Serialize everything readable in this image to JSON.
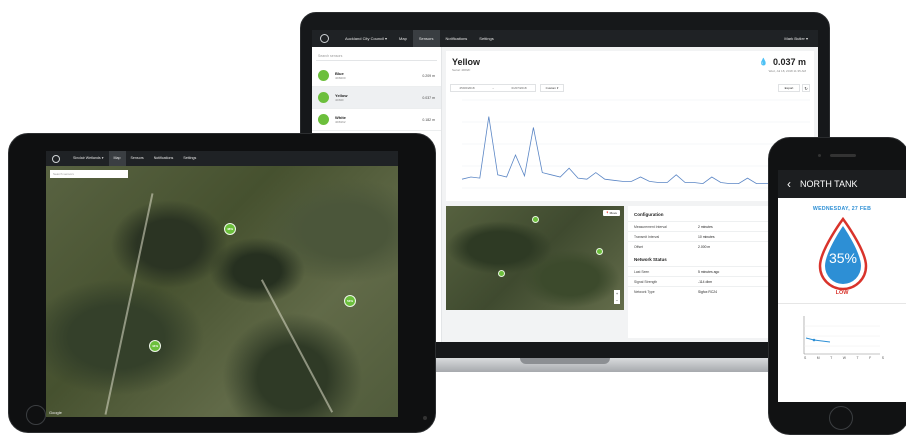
{
  "laptop": {
    "nav": {
      "org": "Auckland City Council ▾",
      "items": [
        "Map",
        "Sensors",
        "Notifications",
        "Settings"
      ],
      "active": "Sensors",
      "user": "Mark Butler ▾"
    },
    "sidebar": {
      "search_placeholder": "Search sensors",
      "sensors": [
        {
          "name": "Blue",
          "id": "4D8200",
          "value": "0.209 m"
        },
        {
          "name": "Yellow",
          "id": "4D82F",
          "value": "0.037 m"
        },
        {
          "name": "White",
          "id": "4D8162",
          "value": "0.182 m"
        }
      ]
    },
    "detail": {
      "title": "Yellow",
      "serial": "Serial: 4D82F",
      "reading": "0.037 m",
      "reading_time": "Wed, Jul 18, 2018 11:35 AM",
      "date_from": "25/06/2018",
      "date_arrow": "→",
      "date_to": "01/07/2018",
      "custom_label": "Custom ▾",
      "export_label": "Export",
      "refresh_glyph": "↻"
    },
    "map": {
      "move_label": "Move",
      "zoom_in": "+",
      "zoom_out": "−"
    },
    "configuration": {
      "heading": "Configuration",
      "rows": [
        {
          "label": "Measurement Interval",
          "value": "2 minutes"
        },
        {
          "label": "Transmit Interval",
          "value": "10 minutes"
        },
        {
          "label": "Offset",
          "value": "2.000 m"
        }
      ]
    },
    "network": {
      "heading": "Network Status",
      "rows": [
        {
          "label": "Last Seen",
          "value": "5 minutes ago"
        },
        {
          "label": "Signal Strength",
          "value": "-114 dbm"
        },
        {
          "label": "Network Type",
          "value": "Sigfox RC24"
        }
      ]
    }
  },
  "tablet": {
    "nav": {
      "org": "Sinclair Wetlands ▾",
      "items": [
        "Map",
        "Sensors",
        "Notifications",
        "Settings"
      ],
      "active": "Map"
    },
    "search_placeholder": "Search sensors",
    "markers": [
      "48%",
      "53%",
      "44%"
    ],
    "attribution": "Google"
  },
  "phone": {
    "title": "NORTH TANK",
    "date": "WEDNESDAY, 27 FEB",
    "level": "35%",
    "status": "LOW",
    "days": [
      "S",
      "M",
      "T",
      "W",
      "T",
      "F",
      "S"
    ]
  },
  "chart_data": {
    "type": "line",
    "title": "",
    "xlabel": "",
    "ylabel": "",
    "x": [
      0,
      1,
      2,
      3,
      4,
      5,
      6,
      7,
      8,
      9,
      10,
      11,
      12,
      13,
      14,
      15,
      16,
      17,
      18,
      19,
      20,
      21,
      22,
      23,
      24,
      25,
      26,
      27,
      28,
      29,
      30,
      31,
      32,
      33,
      34,
      35,
      36,
      37,
      38,
      39
    ],
    "series": [
      {
        "values": [
          0.08,
          0.1,
          0.09,
          0.65,
          0.12,
          0.1,
          0.3,
          0.11,
          0.55,
          0.14,
          0.12,
          0.1,
          0.18,
          0.09,
          0.08,
          0.14,
          0.08,
          0.07,
          0.06,
          0.06,
          0.1,
          0.06,
          0.05,
          0.05,
          0.12,
          0.05,
          0.05,
          0.04,
          0.1,
          0.05,
          0.04,
          0.04,
          0.09,
          0.04,
          0.04,
          0.04,
          0.04,
          0.04,
          0.04,
          0.04
        ]
      }
    ],
    "ylim": [
      0,
      0.8
    ],
    "colors": {
      "line": "#5b86c5"
    }
  },
  "colors": {
    "accent_green": "#6cbf3c",
    "phone_blue": "#2d8fd5",
    "low_red": "#d9332b"
  }
}
